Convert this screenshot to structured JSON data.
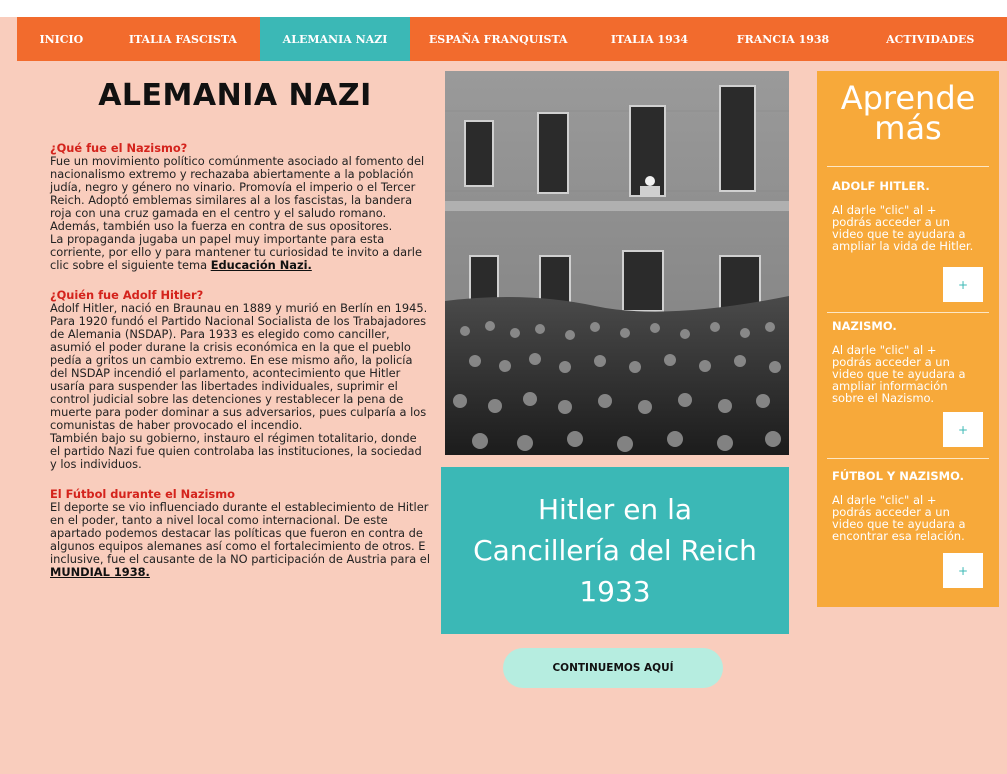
{
  "nav": {
    "items": [
      {
        "label": "INICIO"
      },
      {
        "label": "ITALIA FASCISTA"
      },
      {
        "label": "ALEMANIA NAZI"
      },
      {
        "label": "ESPAÑA FRANQUISTA"
      },
      {
        "label": "ITALIA 1934"
      },
      {
        "label": "FRANCIA 1938"
      },
      {
        "label": "ACTIVIDADES"
      }
    ],
    "active_index": 2
  },
  "main": {
    "title": "ALEMANIA NAZI",
    "section1": {
      "heading": "¿Qué fue el Nazismo?",
      "body": "Fue un movimiento político comúnmente asociado al fomento del nacionalismo extremo y rechazaba abiertamente a la población judía, negro y género no vinario. Promovía el imperio o el Tercer Reich. Adoptó emblemas similares al a los fascistas, la bandera roja con una cruz gamada en el centro y el saludo romano. Además, también uso la fuerza en contra de sus opositores.",
      "body2": "La propaganda jugaba un papel muy importante para esta corriente, por ello y para mantener tu curiosidad te invito a darle clic sobre el siguiente tema",
      "link": "Educación Nazi."
    },
    "section2": {
      "heading": "¿Quién fue Adolf Hitler?",
      "body": "Adolf Hitler, nació en Braunau en 1889 y murió en Berlín en 1945. Para 1920 fundó el Partido Nacional Socialista de los Trabajadores de Alemania (NSDAP). Para 1933 es elegido como canciller, asumió el poder durane la crisis económica en la que el pueblo pedía a gritos un cambio extremo. En ese mismo año, la policía del NSDAP incendió el parlamento, acontecimiento que Hitler usaría para suspender las libertades individuales, suprimir el control judicial sobre las detenciones y restablecer la pena de muerte para poder dominar a sus adversarios, pues culparía a los comunistas de haber provocado el incendio.",
      "body2": "También bajo su gobierno, instauro el régimen totalitario, donde el partido Nazi fue quien controlaba las instituciones, la sociedad y los individuos."
    },
    "section3": {
      "heading": "El Fútbol durante el Nazismo",
      "body": "El deporte se vio influenciado durante el establecimiento de Hitler en el poder, tanto a nivel local como internacional. De este apartado podemos destacar las políticas que fueron en contra de algunos equipos alemanes así como el fortalecimiento de otros. E inclusive, fue el causante de la NO participación de Austria para el",
      "link": "MUNDIAL 1938."
    }
  },
  "caption": "Hitler en la Cancillería del Reich 1933",
  "continue_button": "CONTINUEMOS AQUÍ",
  "sidebar": {
    "title": "Aprende más",
    "items": [
      {
        "heading": "ADOLF HITLER.",
        "text": "Al darle \"clic\" al + podrás acceder a un video que te ayudara a ampliar la vida de Hitler.",
        "button": "+"
      },
      {
        "heading": "NAZISMO.",
        "text": "Al darle \"clic\" al + podrás acceder a un video que te ayudara a ampliar información sobre el Nazismo.",
        "button": "+"
      },
      {
        "heading": "FÚTBOL Y NAZISMO.",
        "text": "Al darle \"clic\" al + podrás acceder a un video que te ayudara a encontrar esa relación.",
        "button": "+"
      }
    ]
  },
  "colors": {
    "nav": "#f26b2d",
    "nav_active": "#3bb8b6",
    "page_bg": "#f9cdbd",
    "heading_red": "#d4231c",
    "sidebar": "#f7a93a",
    "caption_bg": "#3bb8b6",
    "button_bg": "#b6ede0"
  }
}
